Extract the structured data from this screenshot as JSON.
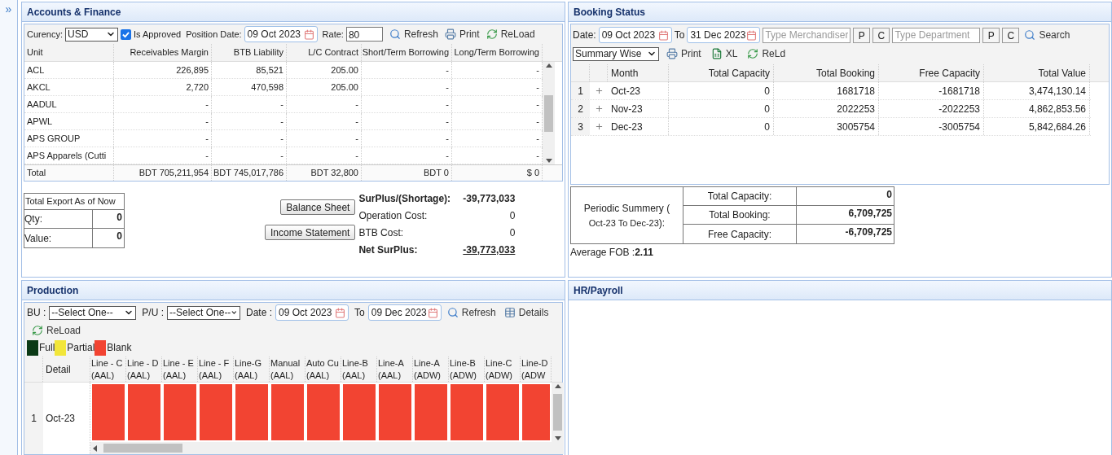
{
  "sidebar": {
    "toggle": "»"
  },
  "accounts": {
    "title": "Accounts & Finance",
    "toolbar": {
      "currency_label": "Curency:",
      "currency": "USD",
      "approved_label": "Is Approved",
      "approved_checked": true,
      "date_label": "Position Date:",
      "date": "09 Oct 2023",
      "rate_label": "Rate:",
      "rate": "80",
      "buttons": [
        "Refresh",
        "Print",
        "ReLoad"
      ]
    },
    "table": {
      "columns": [
        "Unit",
        "Receivables Margin",
        "BTB Liability",
        "L/C Contract",
        "Short/Term Borrowing",
        "Long/Term Borrowing"
      ],
      "rows": [
        [
          "ACL",
          "226,895",
          "85,521",
          "205.00",
          "-",
          "-"
        ],
        [
          "AKCL",
          "2,720",
          "470,598",
          "205.00",
          "-",
          "-"
        ],
        [
          "AADUL",
          "-",
          "-",
          "-",
          "-",
          "-"
        ],
        [
          "APWL",
          "-",
          "-",
          "-",
          "-",
          "-"
        ],
        [
          "APS GROUP",
          "-",
          "-",
          "-",
          "-",
          "-"
        ],
        [
          "APS Apparels (Cutti",
          "-",
          "-",
          "-",
          "-",
          "-"
        ]
      ],
      "total": [
        "Total",
        "BDT 705,211,954",
        "BDT 745,017,786",
        "BDT 32,800",
        "BDT 0",
        "$ 0"
      ]
    },
    "export": {
      "title": "Total Export As of Now",
      "rows": [
        [
          "Qty:",
          "0"
        ],
        [
          "Value:",
          "0"
        ]
      ]
    },
    "buttons": [
      "Balance Sheet",
      "Income Statement"
    ],
    "summary": [
      {
        "label": "SurPlus/(Shortage):",
        "value": "-39,773,033",
        "kind": "bold"
      },
      {
        "label": "Operation Cost:",
        "value": "0",
        "kind": "plain"
      },
      {
        "label": "BTB Cost:",
        "value": "0",
        "kind": "plain"
      },
      {
        "label": "Net SurPlus:",
        "value": "-39,773,033",
        "kind": "total"
      }
    ]
  },
  "booking": {
    "title": "Booking Status",
    "toolbar": {
      "date_label": "Date:",
      "date_from": "09 Oct 2023",
      "to_label": "To",
      "date_to": "31 Dec 2023",
      "merchandiser_placeholder": "Type Merchandiser",
      "merchandiser_buttons": [
        "P",
        "C"
      ],
      "department_placeholder": "Type Department",
      "department_buttons": [
        "P",
        "C"
      ],
      "search": "Search",
      "mode": "Summary Wise",
      "buttons": [
        {
          "label": "Print",
          "kind": "print"
        },
        {
          "label": "XL",
          "kind": "excel"
        },
        {
          "label": "ReLd",
          "kind": "reload"
        }
      ]
    },
    "table": {
      "columns": [
        "Month",
        "Total Capacity",
        "Total Booking",
        "Free Capacity",
        "Total Value"
      ],
      "rows": [
        {
          "no": "1",
          "cells": [
            "Oct-23",
            "0",
            "1681718",
            "-1681718",
            "3,474,130.14"
          ]
        },
        {
          "no": "2",
          "cells": [
            "Nov-23",
            "0",
            "2022253",
            "-2022253",
            "4,862,853.56"
          ]
        },
        {
          "no": "3",
          "cells": [
            "Dec-23",
            "0",
            "3005754",
            "-3005754",
            "5,842,684.26"
          ]
        }
      ]
    },
    "periodic": {
      "label": "Periodic Summery (",
      "range": "Oct-23 To Dec-23",
      "suffix": "):",
      "rows": [
        [
          "Total Capacity:",
          "0"
        ],
        [
          "Total Booking:",
          "6,709,725"
        ],
        [
          "Free Capacity:",
          "-6,709,725"
        ]
      ]
    },
    "average_fob_label": "Average FOB :",
    "average_fob": "2.11"
  },
  "production": {
    "title": "Production",
    "toolbar": {
      "bu_label": "BU :",
      "bu": "--Select One--",
      "pu_label": "P/U :",
      "pu": "--Select One--",
      "date_label": "Date :",
      "date_from": "09 Oct 2023",
      "to_label": "To",
      "date_to": "09 Dec 2023",
      "buttons": [
        "Refresh",
        "Details",
        "ReLoad"
      ]
    },
    "legend": [
      {
        "label": "Full",
        "color": "#0b3a16"
      },
      {
        "label": "Partial",
        "color": "#f2e63a"
      },
      {
        "label": "Blank",
        "color": "#f24432"
      }
    ],
    "grid": {
      "detail_header": "Detail",
      "columns": [
        {
          "line": "Line - C",
          "unit": "(AAL)"
        },
        {
          "line": "Line - D",
          "unit": "(AAL)"
        },
        {
          "line": "Line - E",
          "unit": "(AAL)"
        },
        {
          "line": "Line - F",
          "unit": "(AAL)"
        },
        {
          "line": "Line-G",
          "unit": "(AAL)"
        },
        {
          "line": "Manual",
          "unit": "(AAL)"
        },
        {
          "line": "Auto Cu",
          "unit": "(AAL)"
        },
        {
          "line": "Line-B",
          "unit": "(AAL)"
        },
        {
          "line": "Line-A",
          "unit": "(AAL)"
        },
        {
          "line": "Line-A",
          "unit": "(ADW)"
        },
        {
          "line": "Line-B",
          "unit": "(ADW)"
        },
        {
          "line": "Line-C",
          "unit": "(ADW)"
        },
        {
          "line": "Line-D",
          "unit": "(ADW"
        }
      ],
      "rows": [
        {
          "no": "1",
          "detail": "Oct-23",
          "cells": [
            {
              "color": "#f24432"
            },
            {
              "color": "#f24432"
            },
            {
              "color": "#f24432"
            },
            {
              "color": "#f24432"
            },
            {
              "color": "#f24432"
            },
            {
              "color": "#f24432"
            },
            {
              "color": "#f24432"
            },
            {
              "color": "#f24432"
            },
            {
              "color": "#f24432"
            },
            {
              "color": "#f24432"
            },
            {
              "color": "#f24432"
            },
            {
              "color": "#f24432"
            },
            {
              "color": "#f24432"
            }
          ]
        }
      ]
    }
  },
  "hr": {
    "title": "HR/Payroll"
  }
}
